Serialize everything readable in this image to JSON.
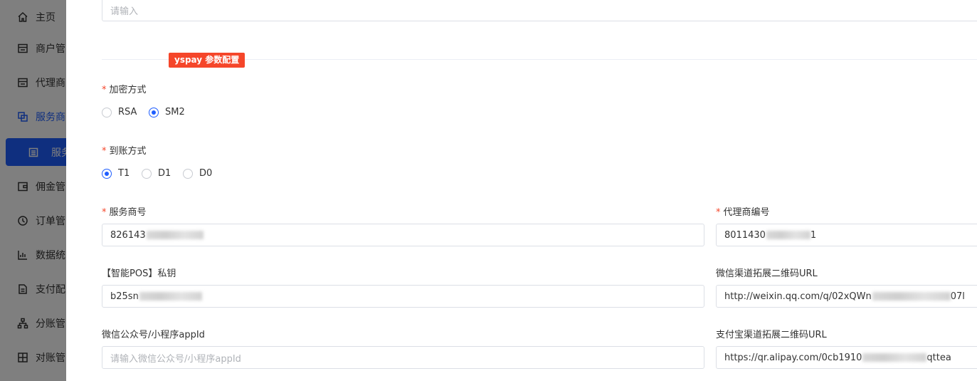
{
  "sidebar": {
    "items": [
      {
        "label": "主页",
        "icon": "home-icon"
      },
      {
        "label": "商户管",
        "icon": "store-icon"
      },
      {
        "label": "代理商",
        "icon": "store-icon"
      },
      {
        "label": "服务商",
        "icon": "copy-icon",
        "active": true
      },
      {
        "label": "佣金管",
        "icon": "wallet-icon"
      },
      {
        "label": "订单管",
        "icon": "clock-icon"
      },
      {
        "label": "数据统",
        "icon": "bar-chart-icon"
      },
      {
        "label": "支付配",
        "icon": "document-icon"
      },
      {
        "label": "分账管",
        "icon": "hierarchy-icon"
      },
      {
        "label": "对账管",
        "icon": "grid-icon"
      }
    ],
    "sub_item": {
      "label": "服务",
      "icon": "list-icon"
    }
  },
  "form": {
    "top_input_placeholder": "请输入",
    "section_title": "yspay 参数配置",
    "encrypt": {
      "label": "加密方式",
      "options": [
        "RSA",
        "SM2"
      ],
      "selected": "SM2"
    },
    "settle": {
      "label": "到账方式",
      "options": [
        "T1",
        "D1",
        "D0"
      ],
      "selected": "T1"
    },
    "service_no": {
      "label": "服务商号",
      "value": "826143"
    },
    "agent_no": {
      "label": "代理商编号",
      "value_prefix": "8011430",
      "value_suffix": "1"
    },
    "pos_key": {
      "label": "【智能POS】私钥",
      "value": "b25sn"
    },
    "wechat_url": {
      "label": "微信渠道拓展二维码URL",
      "value_prefix": "http://weixin.qq.com/q/02xQWn",
      "value_suffix": "07l"
    },
    "appid": {
      "label": "微信公众号/小程序appId",
      "placeholder": "请输入微信公众号/小程序appId"
    },
    "alipay_url": {
      "label": "支付宝渠道拓展二维码URL",
      "value_prefix": "https://qr.alipay.com/0cb1910",
      "value_suffix": "qttea"
    }
  },
  "colors": {
    "primary": "#1f5eff",
    "danger": "#f5462a",
    "border": "#dcdfe6"
  }
}
